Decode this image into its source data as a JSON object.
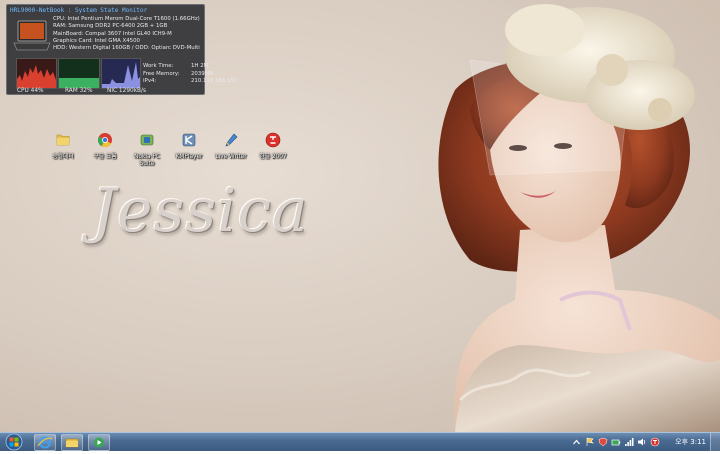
{
  "monitor": {
    "title": "HRL9000-NetBook : System State Monitor",
    "cpu": "CPU:  Intel Pentium Merom Dual-Core T1600 (1.66GHz)",
    "ram": "RAM:  Samsung DDR2 PC-6400 2GB + 1GB",
    "mainboard": "MainBoard: Compal 3607 Intel GL40 ICH9-M",
    "graphics": "Graphics Card:  Intel GMA X4500",
    "hdd": "HDD:  Western Digital 160GB  /  ODD:  Optiarc DVD-Multi",
    "work_time_label": "Work Time:",
    "work_time_value": "1H 2M",
    "free_memory_label": "Free Memory:",
    "free_memory_value": "2039MB",
    "ipv4_label": "IPv4:",
    "ipv4_value": "210.119.188.152",
    "cpu_usage": "CPU 44%",
    "ram_usage": "RAM 32%",
    "nic_usage": "NIC 1290kB/s"
  },
  "desktop_icons": [
    {
      "label": "승결데터",
      "icon": "folder-icon"
    },
    {
      "label": "구글 크롬",
      "icon": "chrome-icon"
    },
    {
      "label": "Nokia PC Suite",
      "icon": "nokia-pc-suite-icon"
    },
    {
      "label": "KMPlayer",
      "icon": "kmplayer-icon"
    },
    {
      "label": "Live Writer",
      "icon": "live-writer-icon"
    },
    {
      "label": "한글 2007",
      "icon": "hangul-2007-icon"
    }
  ],
  "wallpaper": {
    "signature": "Jessica"
  },
  "taskbar": {
    "pinned": [
      "internet-explorer-icon",
      "windows-explorer-icon",
      "media-center-icon"
    ],
    "clock": "오후 3:11"
  },
  "colors": {
    "taskbar": "#4a6b92",
    "monitor_bg": "#1c1e24",
    "monitor_title": "#6fb8ff",
    "cpu_graph": "#d94030",
    "ram_graph": "#3bb060",
    "nic_graph": "#6b70c8"
  }
}
